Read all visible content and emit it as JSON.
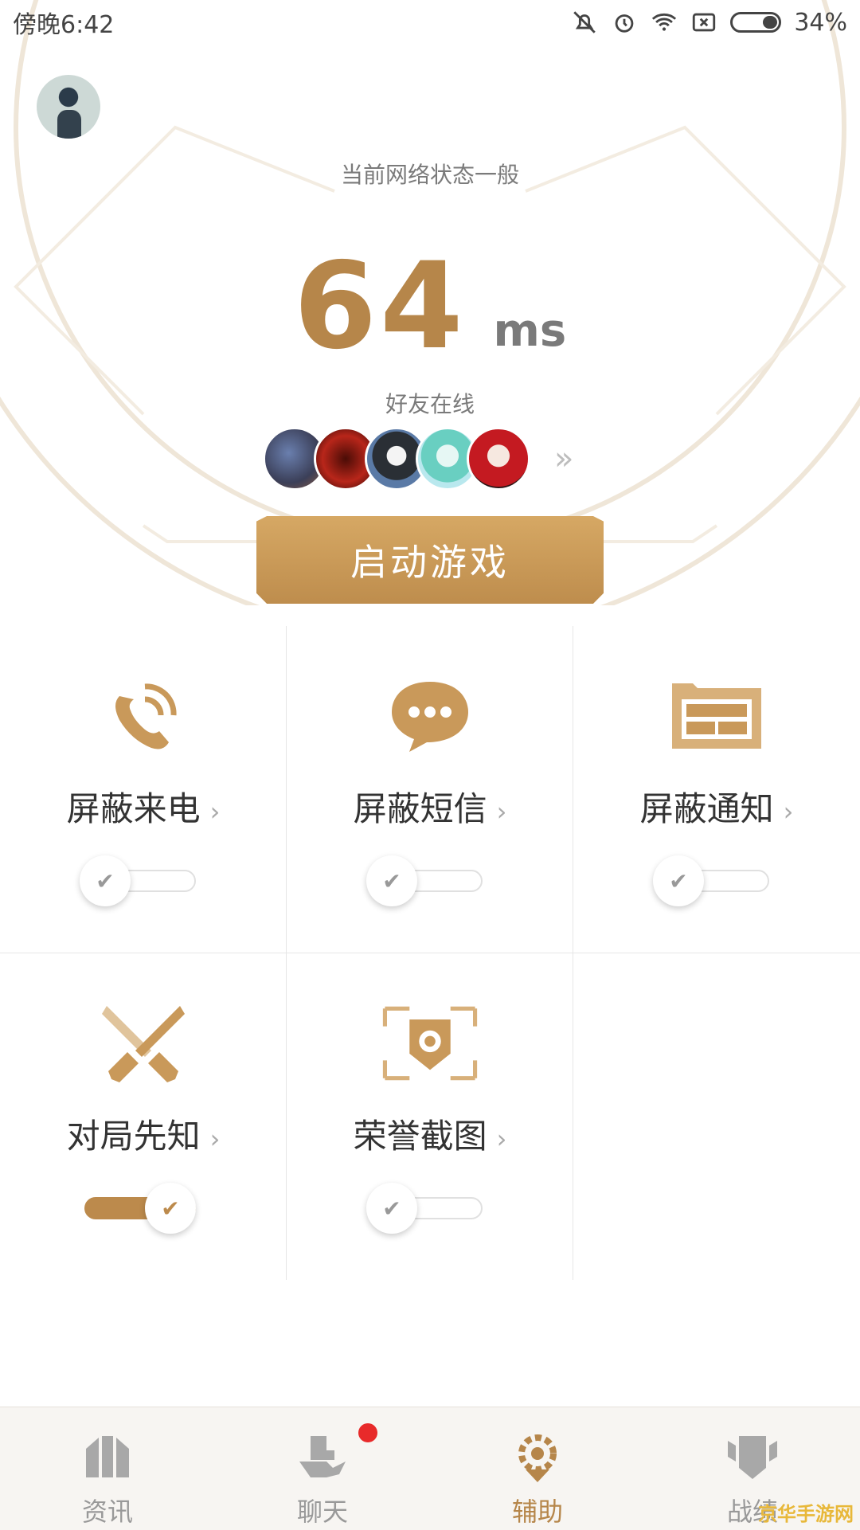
{
  "status_bar": {
    "time": "傍晚6:42",
    "battery": "34%"
  },
  "header": {
    "avatar": "avatar"
  },
  "network": {
    "status_text": "当前网络状态一般",
    "latency_value": "64",
    "latency_unit": "ms"
  },
  "friends": {
    "label": "好友在线",
    "count": 5,
    "arrow": "»"
  },
  "start_button": {
    "label": "启动游戏"
  },
  "features": [
    {
      "label": "屏蔽来电",
      "icon": "phone-icon",
      "enabled": false
    },
    {
      "label": "屏蔽短信",
      "icon": "message-icon",
      "enabled": false
    },
    {
      "label": "屏蔽通知",
      "icon": "notification-icon",
      "enabled": false
    },
    {
      "label": "对局先知",
      "icon": "crossed-swords-icon",
      "enabled": true
    },
    {
      "label": "荣誉截图",
      "icon": "screenshot-icon",
      "enabled": false
    }
  ],
  "chevron": "›",
  "check": "✔",
  "bottom_nav": [
    {
      "label": "资讯",
      "icon": "news-icon"
    },
    {
      "label": "聊天",
      "icon": "chat-icon",
      "badge": true
    },
    {
      "label": "辅助",
      "icon": "assist-icon",
      "active": true
    },
    {
      "label": "战绩",
      "icon": "record-icon"
    }
  ],
  "watermark": "京华手游网",
  "colors": {
    "accent": "#b6864a",
    "badge": "#e82a2a"
  }
}
